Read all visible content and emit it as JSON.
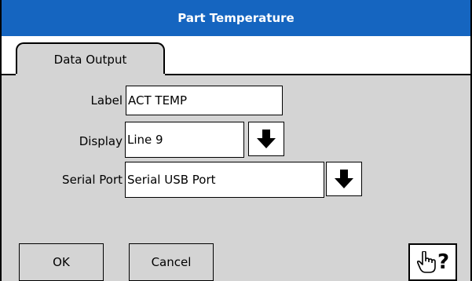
{
  "window": {
    "title": "Part Temperature"
  },
  "tabs": [
    {
      "label": "Data Output",
      "selected": true
    }
  ],
  "form": {
    "label": {
      "caption": "Label",
      "value": "ACT TEMP"
    },
    "display": {
      "caption": "Display",
      "value": "Line 9"
    },
    "serial_port": {
      "caption": "Serial Port",
      "value": "Serial USB Port"
    }
  },
  "buttons": {
    "ok": "OK",
    "cancel": "Cancel",
    "help": "?"
  },
  "icons": {
    "dropdown": "arrow-down-icon",
    "help": "pointing-hand-help-icon"
  },
  "colors": {
    "titlebar": "#1565c0",
    "panel": "#d4d4d4"
  }
}
